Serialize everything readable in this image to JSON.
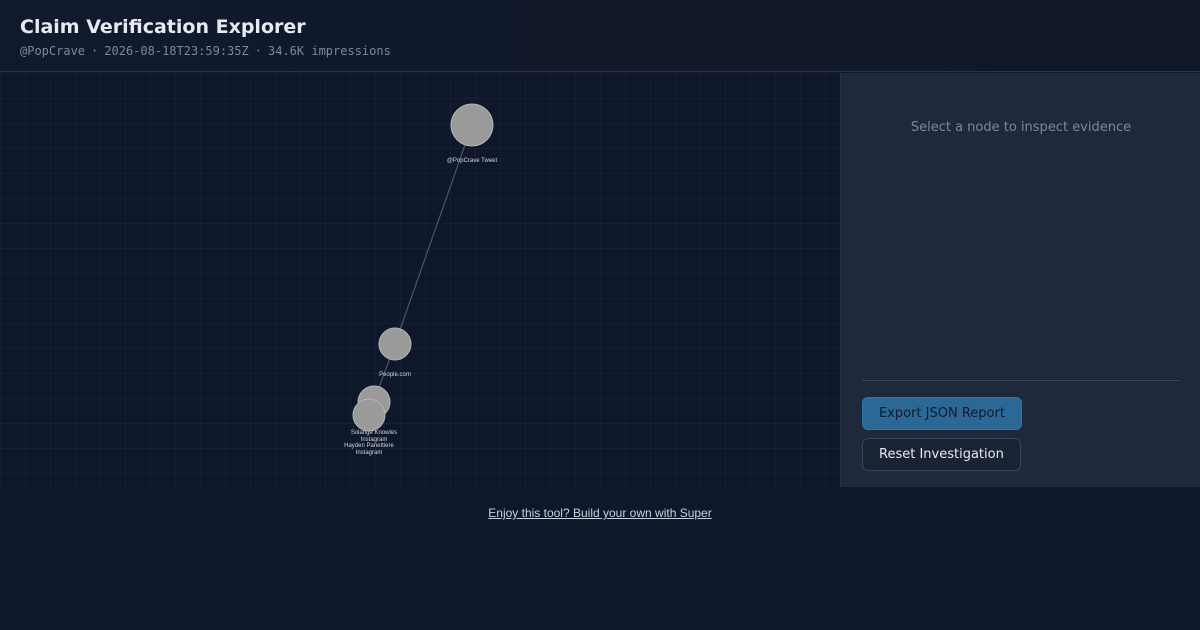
{
  "header": {
    "title": "Claim Verification Explorer",
    "handle": "@PopCrave",
    "timestamp": "2026-08-18T23:59:35Z",
    "impressions": "34.6K impressions",
    "separator": "·"
  },
  "graph": {
    "node_color": "#9a9a9a",
    "edge_color": "#4a5568",
    "nodes": [
      {
        "id": "tweet",
        "label_lines": [
          "@PopCrave Tweet"
        ]
      },
      {
        "id": "people",
        "label_lines": [
          "People.com"
        ]
      },
      {
        "id": "solange",
        "label_lines": [
          "Solange Knowles",
          "Instagram"
        ]
      },
      {
        "id": "hayden",
        "label_lines": [
          "Hayden Panettiere",
          "Instagram"
        ]
      }
    ]
  },
  "panel": {
    "hint": "Select a node to inspect evidence",
    "export_label": "Export JSON Report",
    "reset_label": "Reset Investigation"
  },
  "footer": {
    "link_text": "Enjoy this tool? Build your own with Super"
  }
}
